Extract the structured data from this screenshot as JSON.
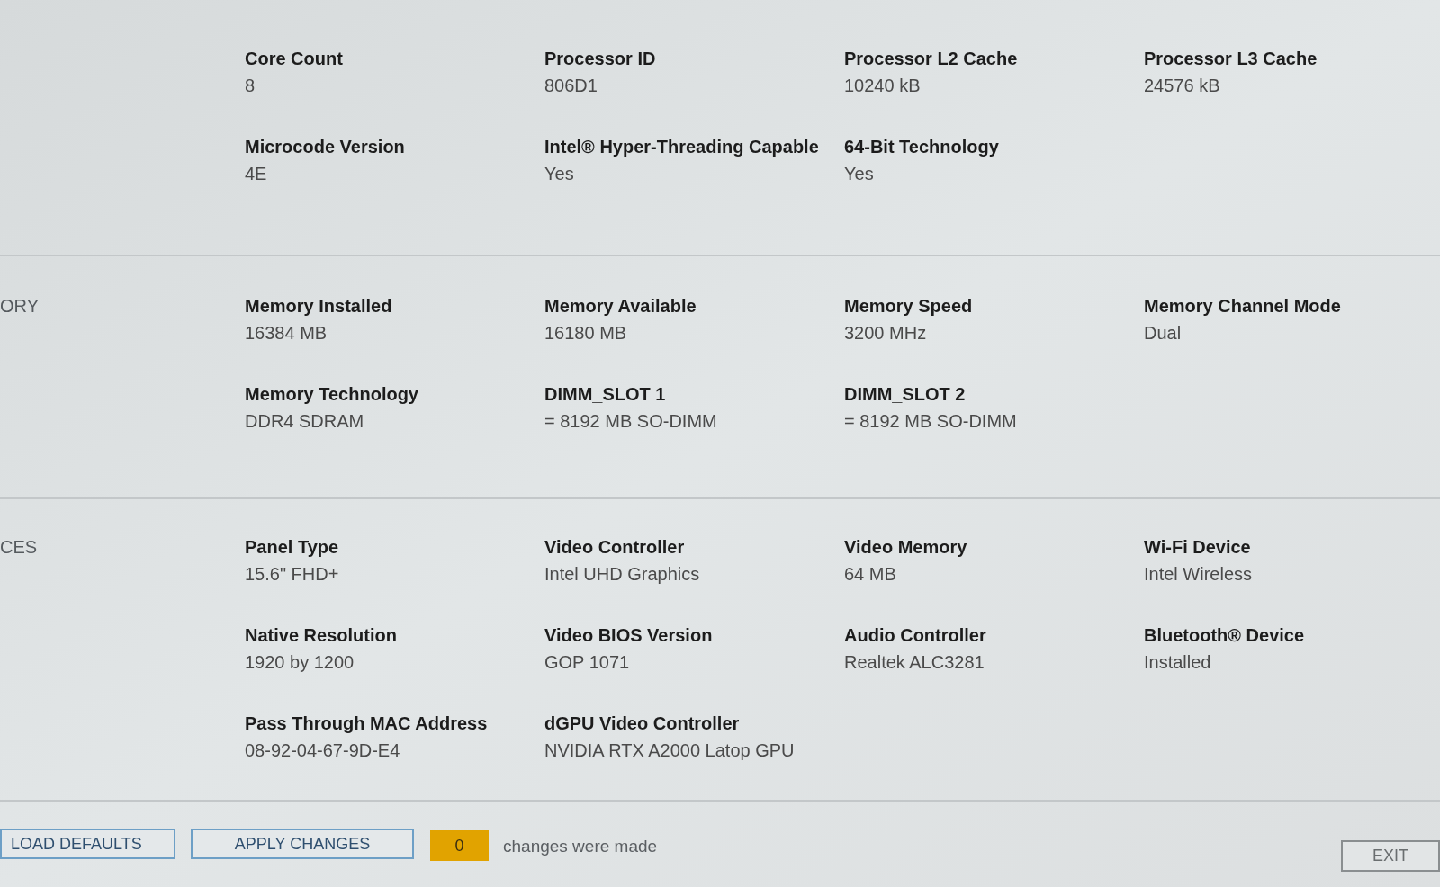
{
  "sections": [
    {
      "rows": [
        [
          {
            "label": "Core Count",
            "value": "8"
          },
          {
            "label": "Processor ID",
            "value": "806D1"
          },
          {
            "label": "Processor L2 Cache",
            "value": "10240 kB"
          },
          {
            "label": "Processor L3 Cache",
            "value": "24576 kB"
          }
        ],
        [
          {
            "label": "Microcode Version",
            "value": "4E"
          },
          {
            "label": "Intel® Hyper-Threading Capable",
            "value": "Yes"
          },
          {
            "label": "64-Bit Technology",
            "value": "Yes"
          }
        ]
      ]
    },
    {
      "label": "ORY",
      "rows": [
        [
          {
            "label": "Memory Installed",
            "value": "16384 MB"
          },
          {
            "label": "Memory Available",
            "value": "16180 MB"
          },
          {
            "label": "Memory Speed",
            "value": "3200 MHz"
          },
          {
            "label": "Memory Channel Mode",
            "value": "Dual"
          }
        ],
        [
          {
            "label": "Memory Technology",
            "value": "DDR4 SDRAM"
          },
          {
            "label": "DIMM_SLOT 1",
            "value": "= 8192 MB SO-DIMM"
          },
          {
            "label": "DIMM_SLOT 2",
            "value": "= 8192 MB SO-DIMM"
          }
        ]
      ]
    },
    {
      "label": "CES",
      "rows": [
        [
          {
            "label": "Panel Type",
            "value": "15.6\" FHD+"
          },
          {
            "label": "Video Controller",
            "value": "Intel UHD Graphics"
          },
          {
            "label": "Video Memory",
            "value": "64 MB"
          },
          {
            "label": "Wi-Fi Device",
            "value": "Intel Wireless"
          }
        ],
        [
          {
            "label": "Native Resolution",
            "value": "1920 by 1200"
          },
          {
            "label": "Video BIOS Version",
            "value": "GOP 1071"
          },
          {
            "label": "Audio Controller",
            "value": "Realtek ALC3281"
          },
          {
            "label": "Bluetooth® Device",
            "value": "Installed"
          }
        ],
        [
          {
            "label": "Pass Through MAC Address",
            "value": "08-92-04-67-9D-E4"
          },
          {
            "label": "dGPU Video Controller",
            "value": "NVIDIA RTX A2000 Latop GPU"
          }
        ]
      ]
    }
  ],
  "footer": {
    "load_defaults": "LOAD DEFAULTS",
    "apply_changes": "APPLY CHANGES",
    "changes_count": "0",
    "changes_text": "changes were made",
    "exit": "EXIT"
  }
}
